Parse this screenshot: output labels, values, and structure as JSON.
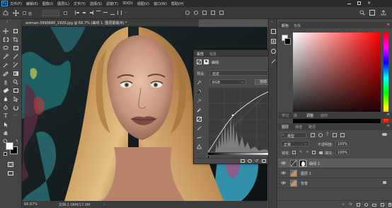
{
  "app": {
    "logo_text": "Ps"
  },
  "menu": [
    "文件(F)",
    "编辑(E)",
    "图像(I)",
    "图层(L)",
    "文字(Y)",
    "选择(S)",
    "滤镜(T)",
    "3D(D)",
    "视图(V)",
    "窗口(W)",
    "帮助(H)"
  ],
  "document": {
    "tab_title": "woman-3990680_1920.jpg @ 66.7% (曲线 1, 图层蒙版/8) *",
    "zoom": "66.67%",
    "doc_size": "文档:2.06M/17.0M"
  },
  "properties": {
    "tabs": [
      "属性",
      "信息"
    ],
    "panel_title": "曲线",
    "preset_label": "预设:",
    "preset_value": "自定",
    "channel": "RGB",
    "auto_button": "自动"
  },
  "color_panel": {
    "tabs": [
      "颜色",
      "色板"
    ],
    "base_hue_color": "#ff0000"
  },
  "adjust_tabs": [
    "学习",
    "库",
    "调整",
    "动作"
  ],
  "layers_panel": {
    "tabs": [
      "图层",
      "通道",
      "路径"
    ],
    "kind_filter": "类型",
    "blend_mode": "正常",
    "opacity_label": "不透明度:",
    "opacity_value": "100%",
    "lock_label": "锁定:",
    "fill_label": "填充:",
    "fill_value": "100%",
    "layers": [
      {
        "name": "曲线 1",
        "visible": true,
        "type": "adjustment",
        "selected": true
      },
      {
        "name": "图层 1",
        "visible": true,
        "type": "pixel",
        "selected": false
      },
      {
        "name": "背景",
        "visible": true,
        "type": "background",
        "selected": false
      }
    ]
  }
}
